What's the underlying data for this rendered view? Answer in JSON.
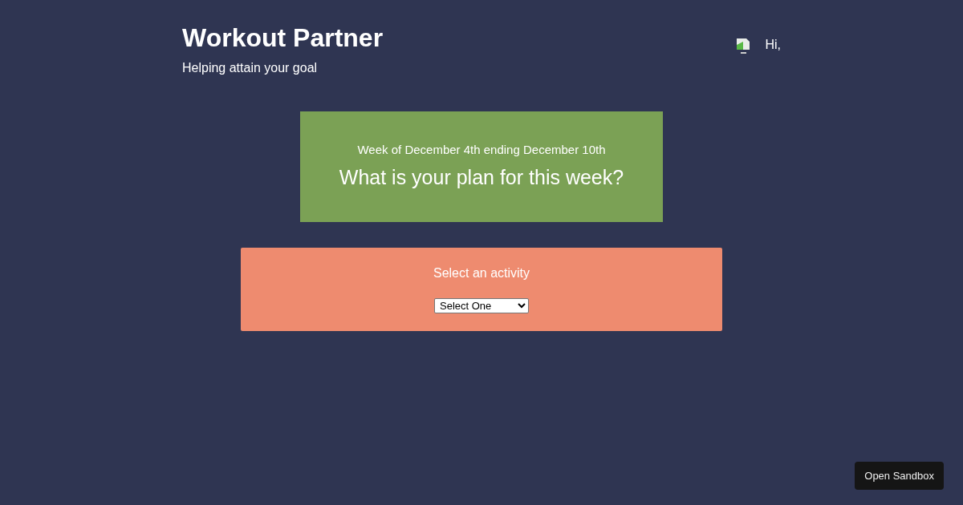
{
  "header": {
    "title": "Workout Partner",
    "subtitle": "Helping attain your goal",
    "greeting": "Hi,"
  },
  "week_card": {
    "dates": "Week of December 4th ending December 10th",
    "question": "What is your plan for this week?"
  },
  "activity_card": {
    "label": "Select an activity",
    "select": {
      "value": "Select One"
    }
  },
  "sandbox_button": "Open Sandbox"
}
